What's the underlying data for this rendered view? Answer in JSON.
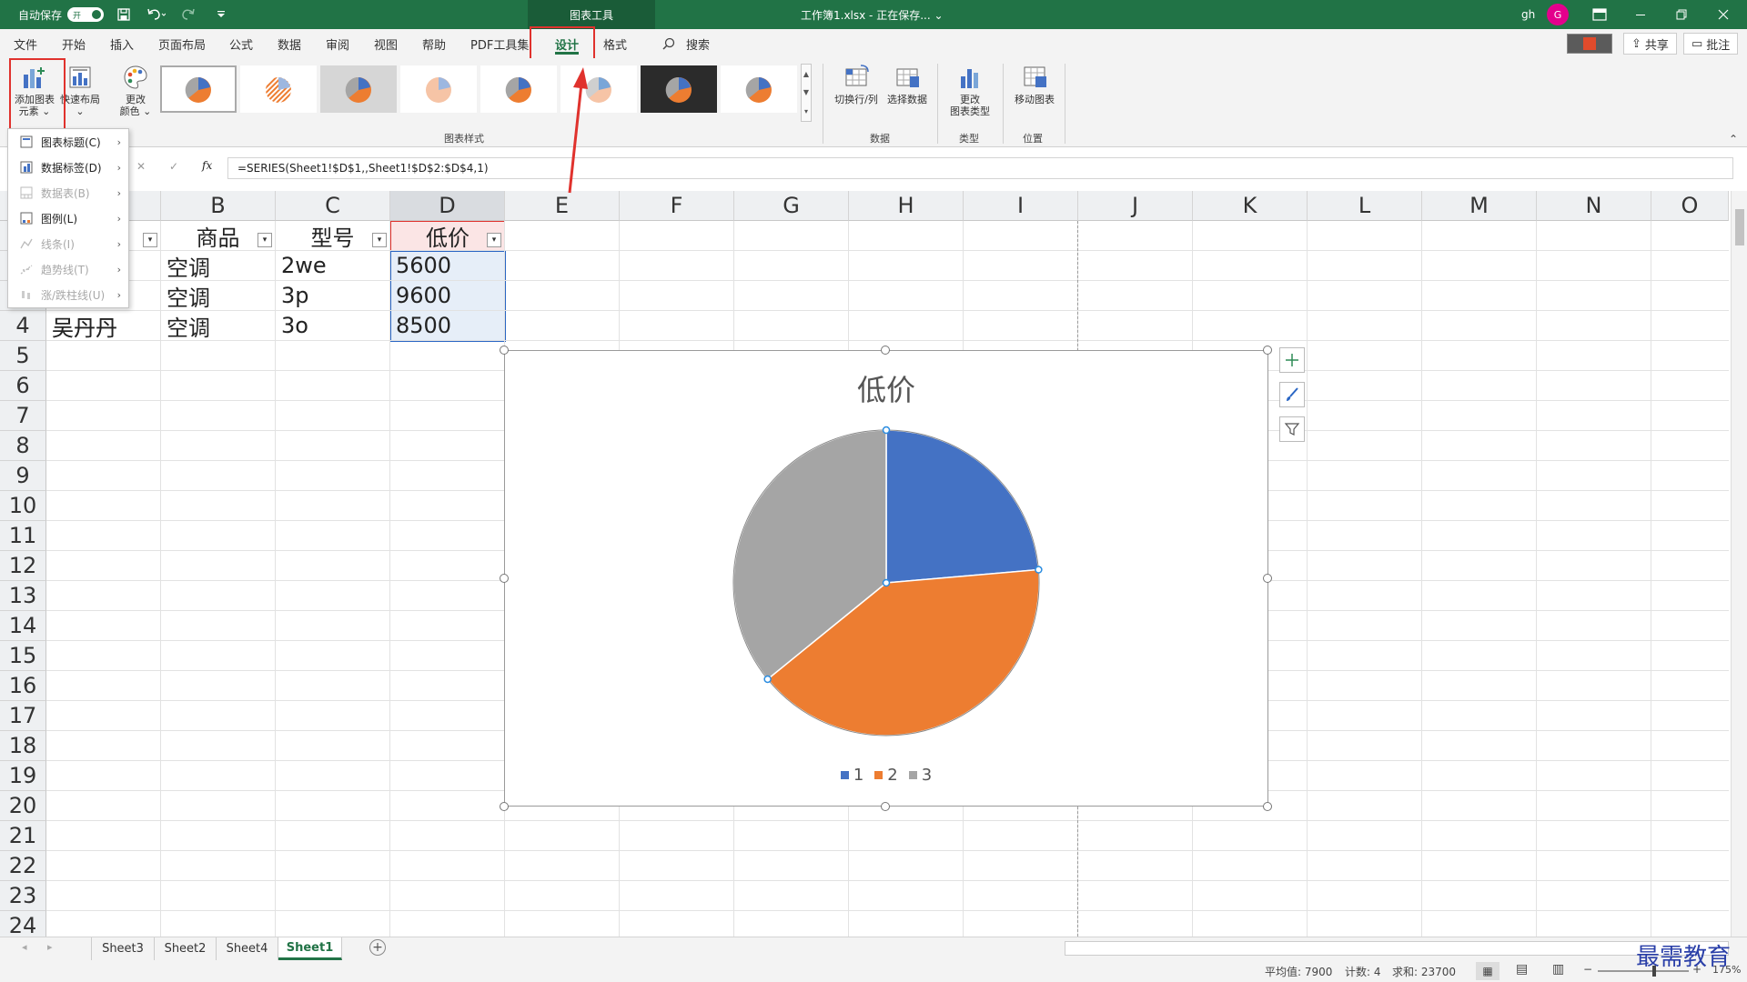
{
  "titlebar": {
    "autosave_label": "自动保存",
    "autosave_state": "开",
    "chart_tools": "图表工具",
    "file_title": "工作簿1.xlsx - 正在保存... ⌄",
    "user": "gh",
    "avatar_letter": "G"
  },
  "tabs": {
    "file": "文件",
    "home": "开始",
    "insert": "插入",
    "page_layout": "页面布局",
    "formulas": "公式",
    "data": "数据",
    "review": "审阅",
    "view": "视图",
    "help": "帮助",
    "pdf": "PDF工具集",
    "design": "设计",
    "format": "格式",
    "search": "搜索",
    "share": "共享",
    "comments": "批注"
  },
  "ribbon": {
    "add_element": "添加图表\n元素 ⌄",
    "quick_layout": "快速布局\n⌄",
    "change_color": "更改\n颜色 ⌄",
    "styles_group": "图表样式",
    "switch_rowcol": "切换行/列",
    "select_data": "选择数据",
    "data_group": "数据",
    "change_type": "更改\n图表类型",
    "type_group": "类型",
    "move_chart": "移动图表",
    "location_group": "位置"
  },
  "dropdown": {
    "items": [
      {
        "label": "图表标题(C)",
        "enabled": true
      },
      {
        "label": "数据标签(D)",
        "enabled": true
      },
      {
        "label": "数据表(B)",
        "enabled": false
      },
      {
        "label": "图例(L)",
        "enabled": true
      },
      {
        "label": "线条(I)",
        "enabled": false
      },
      {
        "label": "趋势线(T)",
        "enabled": false
      },
      {
        "label": "涨/跌柱线(U)",
        "enabled": false
      }
    ]
  },
  "formula": {
    "cancel": "✕",
    "enter": "✓",
    "fx": "fx",
    "text": "=SERIES(Sheet1!$D$1,,Sheet1!$D$2:$D$4,1)"
  },
  "grid": {
    "columns": [
      "B",
      "C",
      "D",
      "E",
      "F",
      "G",
      "H",
      "I",
      "J",
      "K",
      "L",
      "M",
      "N",
      "O"
    ],
    "rows": [
      "4",
      "5",
      "6",
      "7",
      "8",
      "9",
      "10",
      "11",
      "12",
      "13",
      "14",
      "15",
      "16",
      "17",
      "18",
      "19",
      "20",
      "21",
      "22",
      "23",
      "24"
    ],
    "header_row": {
      "b": "商品",
      "c": "型号",
      "d": "低价"
    },
    "data_rows": [
      {
        "a": "",
        "b": "空调",
        "c": "2we",
        "d": "5600"
      },
      {
        "a": "",
        "b": "空调",
        "c": "3p",
        "d": "9600"
      },
      {
        "a": "吴丹丹",
        "b": "空调",
        "c": "3o",
        "d": "8500"
      }
    ]
  },
  "chart_data": {
    "type": "pie",
    "title": "低价",
    "categories": [
      "1",
      "2",
      "3"
    ],
    "values": [
      5600,
      9600,
      8500
    ],
    "colors": [
      "#4472c4",
      "#ed7d31",
      "#a5a5a5"
    ],
    "legend": "bottom"
  },
  "sheets": {
    "tabs": [
      "Sheet3",
      "Sheet2",
      "Sheet4",
      "Sheet1"
    ],
    "active": "Sheet1"
  },
  "status": {
    "average": "平均值: 7900",
    "count": "计数: 4",
    "sum": "求和: 23700",
    "zoom": "175%"
  },
  "watermark": "最需教育",
  "colors": {
    "accent": "#217346",
    "highlight": "#e0322d"
  }
}
